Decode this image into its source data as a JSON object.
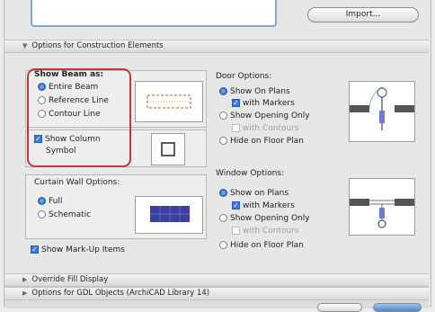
{
  "import_button": "Import...",
  "sections": {
    "construction": "Options for Construction Elements",
    "override": "Override Fill Display",
    "gdl": "Options for GDL Objects (ArchiCAD Library 14)"
  },
  "show_beam": {
    "title": "Show Beam as:",
    "options": [
      "Entire Beam",
      "Reference Line",
      "Contour Line"
    ],
    "selected": 0
  },
  "column": {
    "line1": "Show Column",
    "line2": "Symbol"
  },
  "curtain_wall": {
    "title": "Curtain Wall Options:",
    "options": [
      "Full",
      "Schematic"
    ],
    "selected": 0
  },
  "markup": "Show Mark-Up Items",
  "door": {
    "title": "Door Options:",
    "show_on_plans": "Show On Plans",
    "with_markers": "with Markers",
    "show_opening_only": "Show Opening Only",
    "with_contours": "with Contours",
    "hide": "Hide on Floor Plan"
  },
  "window": {
    "title": "Window Options:",
    "show_on_plans": "Show on Plans",
    "with_markers": "with Markers",
    "show_opening_only": "Show Opening Only",
    "with_contours": "with Contours",
    "hide": "Hide on Floor Plan"
  },
  "colors": {
    "highlight": "#c8343b",
    "accent": "#3c78d4",
    "schematic": "#3d3fa0"
  }
}
